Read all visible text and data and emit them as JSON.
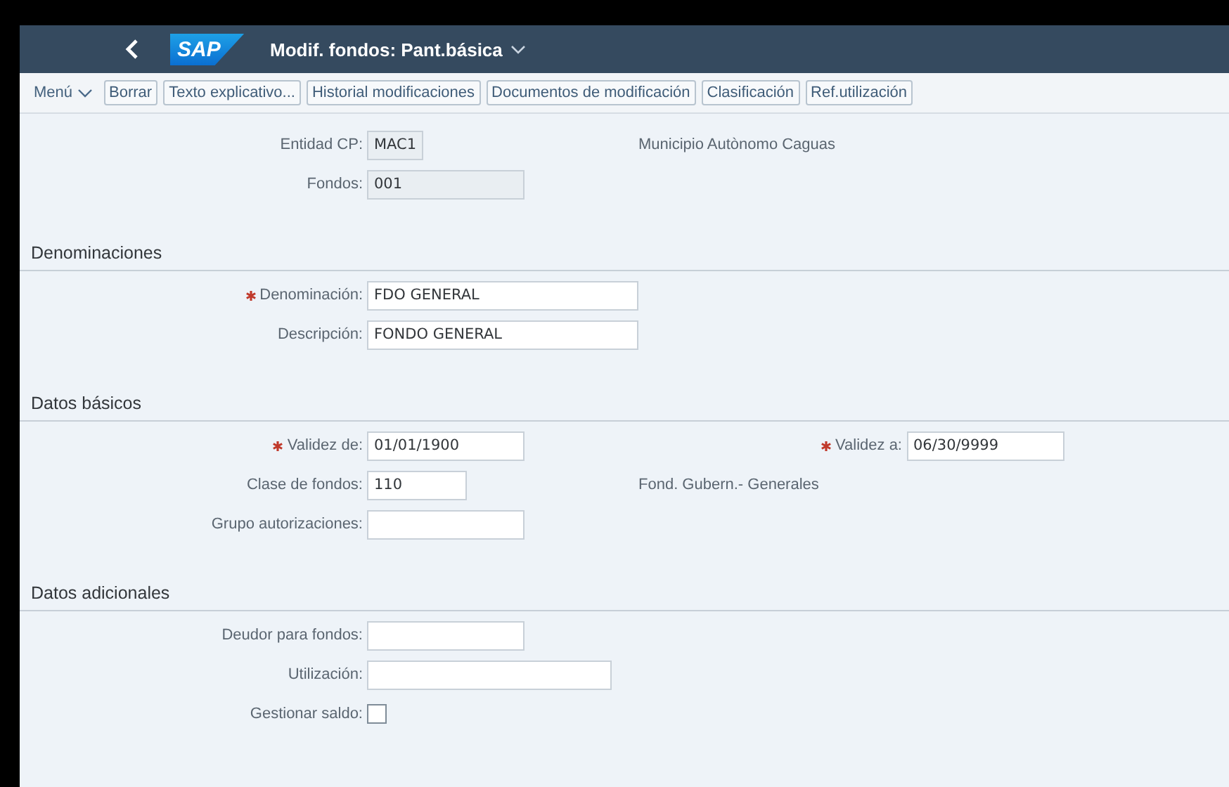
{
  "header": {
    "logo": "SAP",
    "title": "Modif. fondos: Pant.básica"
  },
  "toolbar": {
    "menu": "Menú",
    "buttons": [
      "Borrar",
      "Texto explicativo...",
      "Historial modificaciones",
      "Documentos de modificación",
      "Clasificación",
      "Ref.utilización"
    ]
  },
  "sections": [
    {
      "rows": [
        {
          "kind": "field",
          "label": "Entidad CP:",
          "value": "MAC1",
          "readonly": true,
          "required": false,
          "note": "Municipio Autònomo Caguas"
        },
        {
          "kind": "field",
          "label": "Fondos:",
          "value": "001",
          "readonly": true,
          "required": false
        }
      ]
    },
    {
      "title": "Denominaciones",
      "rows": [
        {
          "kind": "field",
          "label": "Denominación:",
          "value": "FDO GENERAL",
          "readonly": false,
          "required": true
        },
        {
          "kind": "field",
          "label": "Descripción:",
          "value": "FONDO GENERAL",
          "readonly": false,
          "required": false
        }
      ]
    },
    {
      "title": "Datos básicos",
      "rows": [
        {
          "kind": "field",
          "label": "Validez de:",
          "value": "01/01/1900",
          "readonly": false,
          "required": true,
          "second": {
            "label": "Validez a:",
            "value": "06/30/9999",
            "required": true
          }
        },
        {
          "kind": "field",
          "label": "Clase de fondos:",
          "value": "110",
          "readonly": false,
          "required": false,
          "note": "Fond. Gubern.- Generales"
        },
        {
          "kind": "field",
          "label": "Grupo autorizaciones:",
          "readonly": false,
          "required": false
        }
      ]
    },
    {
      "title": "Datos adicionales",
      "rows": [
        {
          "kind": "field",
          "label": "Deudor para fondos:",
          "readonly": false,
          "required": false
        },
        {
          "kind": "field",
          "label": "Utilización:",
          "readonly": false,
          "required": false
        },
        {
          "kind": "checkbox",
          "label": "Gestionar saldo:",
          "checked": false
        }
      ]
    }
  ]
}
